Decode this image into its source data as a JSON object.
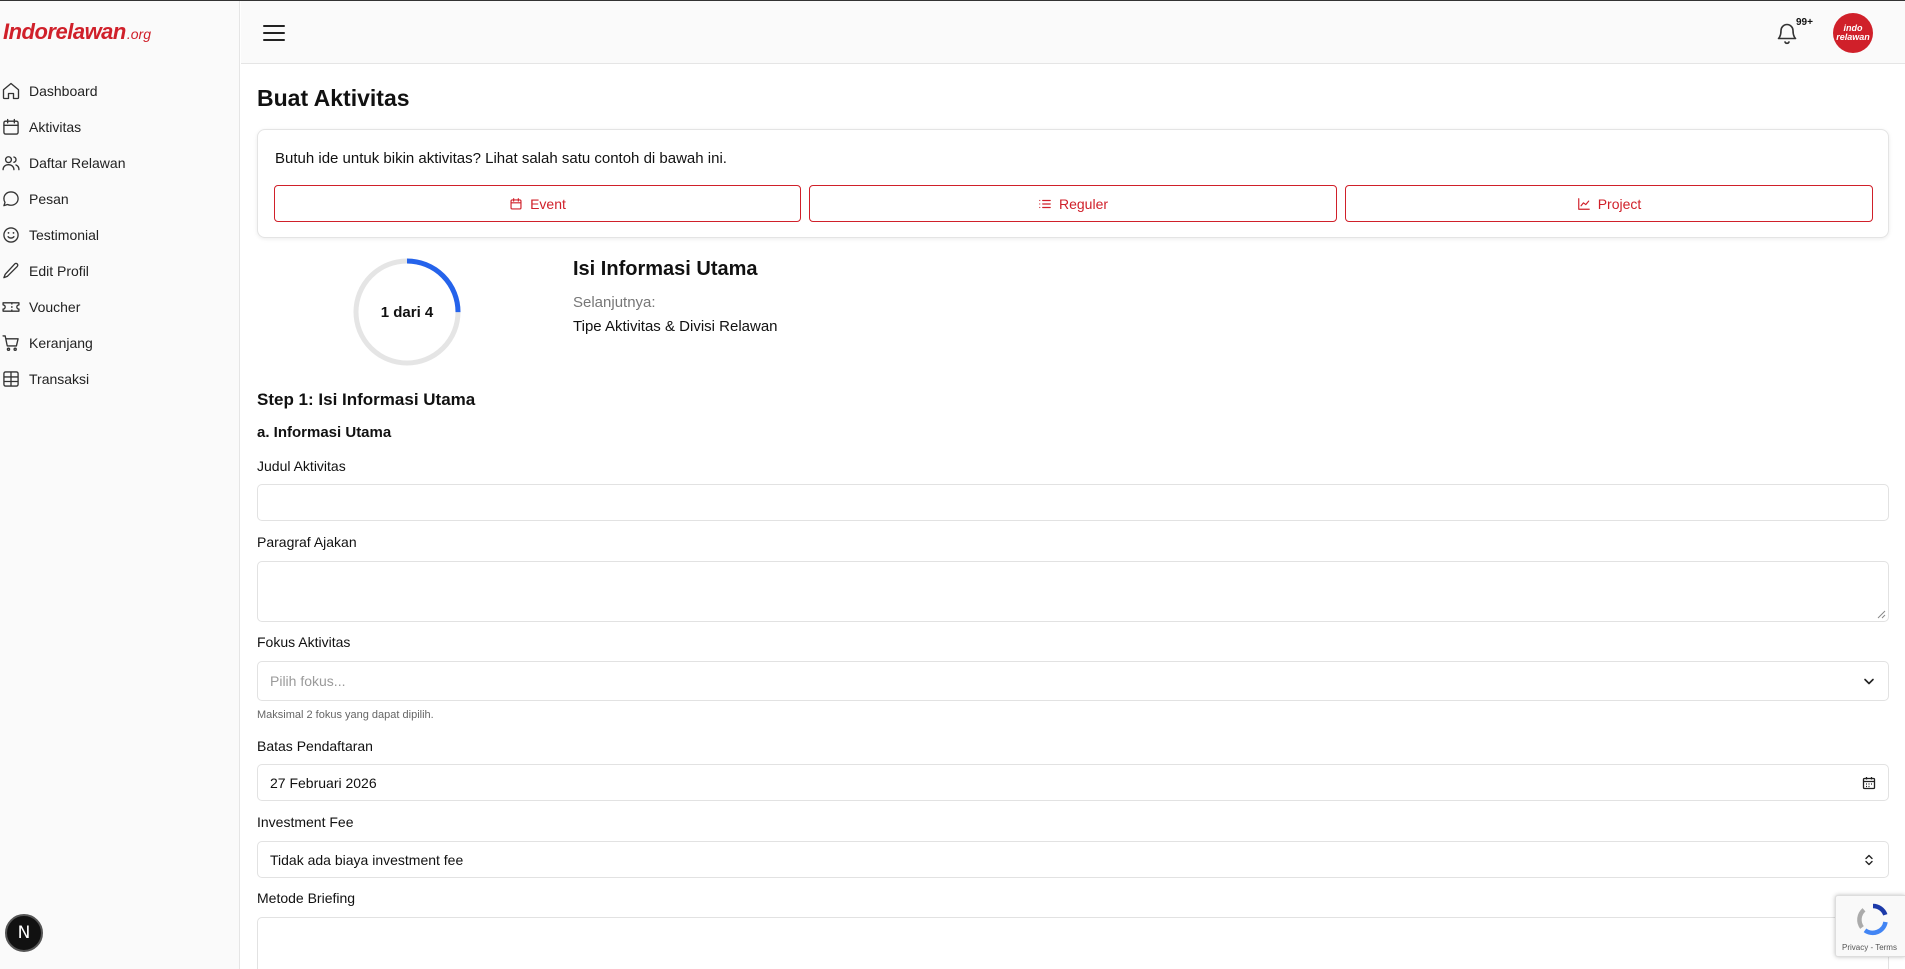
{
  "brand": {
    "name": "Indorelawan",
    "suffix": ".org",
    "accent": "#d0202a"
  },
  "sidebar": {
    "items": [
      {
        "label": "Dashboard",
        "icon": "home-icon"
      },
      {
        "label": "Aktivitas",
        "icon": "calendar-icon"
      },
      {
        "label": "Daftar Relawan",
        "icon": "users-icon"
      },
      {
        "label": "Pesan",
        "icon": "message-icon"
      },
      {
        "label": "Testimonial",
        "icon": "smile-icon"
      },
      {
        "label": "Edit Profil",
        "icon": "pencil-icon"
      },
      {
        "label": "Voucher",
        "icon": "ticket-icon"
      },
      {
        "label": "Keranjang",
        "icon": "cart-icon"
      },
      {
        "label": "Transaksi",
        "icon": "table-icon"
      }
    ],
    "dev_badge": "N"
  },
  "header": {
    "notification_count": "99+",
    "avatar_line1": "indo",
    "avatar_line2": "relawan"
  },
  "page": {
    "title": "Buat Aktivitas",
    "idea_text": "Butuh ide untuk bikin aktivitas? Lihat salah satu contoh di bawah ini.",
    "idea_buttons": [
      {
        "label": "Event",
        "icon": "calendar-icon"
      },
      {
        "label": "Reguler",
        "icon": "list-icon"
      },
      {
        "label": "Project",
        "icon": "line-chart-icon"
      }
    ]
  },
  "progress": {
    "label": "1 dari 4",
    "current_step": 1,
    "total_steps": 4,
    "fraction": 0.25,
    "track_color": "#e5e5e5",
    "fill_color": "#2563eb",
    "title": "Isi Informasi Utama",
    "next_label": "Selanjutnya:",
    "next_value": "Tipe Aktivitas & Divisi Relawan"
  },
  "form": {
    "step_heading": "Step 1: Isi Informasi Utama",
    "section_heading": "a. Informasi Utama",
    "judul_label": "Judul Aktivitas",
    "judul_value": "",
    "paragraf_label": "Paragraf Ajakan",
    "paragraf_value": "",
    "fokus_label": "Fokus Aktivitas",
    "fokus_placeholder": "Pilih fokus...",
    "fokus_helper": "Maksimal 2 fokus yang dapat dipilih.",
    "batas_label": "Batas Pendaftaran",
    "batas_value": "27 Februari 2026",
    "fee_label": "Investment Fee",
    "fee_value": "Tidak ada biaya investment fee",
    "briefing_label": "Metode Briefing",
    "briefing_value": ""
  },
  "recaptcha": {
    "text": "Privacy - Terms"
  }
}
